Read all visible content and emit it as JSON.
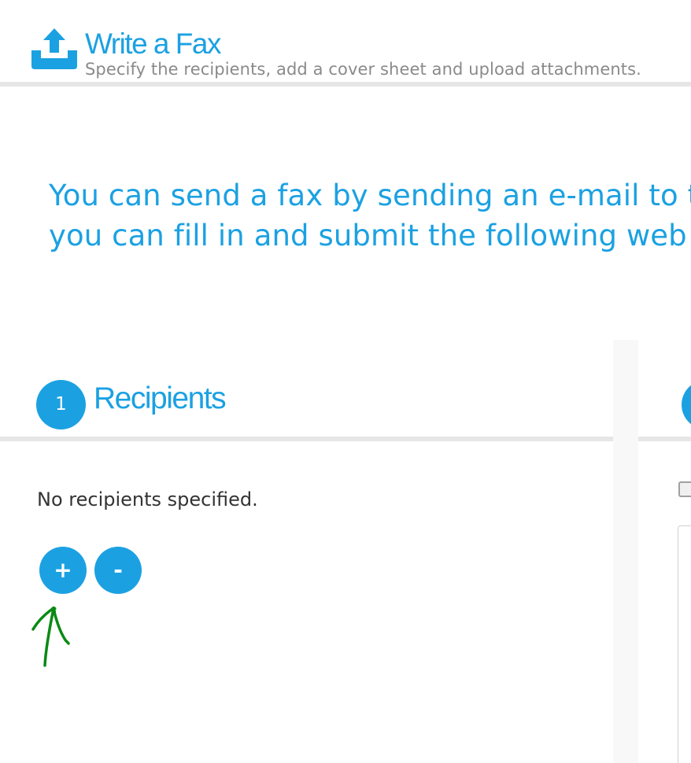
{
  "header": {
    "icon": "upload-tray-icon",
    "title": "Write a Fax",
    "subtitle": "Specify the recipients, add a cover sheet and upload attachments."
  },
  "intro": {
    "line1": "You can send a fax by sending an e-mail to t",
    "line2": "you can fill in and submit the following web"
  },
  "recipients": {
    "step_number": "1",
    "title": "Recipients",
    "empty_text": "No recipients specified.",
    "add_label": "+",
    "remove_label": "-"
  },
  "annotation": {
    "icon": "hand-drawn-up-arrow-icon",
    "color": "#0a8a14"
  },
  "colors": {
    "accent": "#1ba1e2",
    "rule": "#e6e6e6",
    "text": "#333333",
    "muted": "#8a8a8a"
  }
}
